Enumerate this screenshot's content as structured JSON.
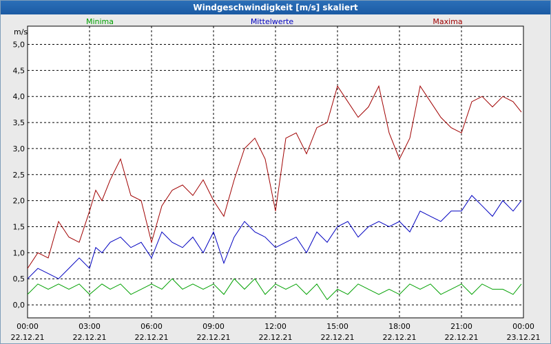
{
  "window": {
    "title": "Windgeschwindigkeit [m/s] skaliert"
  },
  "chart_data": {
    "type": "line",
    "ylabel": "m/s",
    "ylim": [
      -0.25,
      5.35
    ],
    "yticks": [
      0.0,
      0.5,
      1.0,
      1.5,
      2.0,
      2.5,
      3.0,
      3.5,
      4.0,
      4.5,
      5.0
    ],
    "ytick_labels": [
      "0,0",
      "0,5",
      "1,0",
      "1,5",
      "2,0",
      "2,5",
      "3,0",
      "3,5",
      "4,0",
      "4,5",
      "5,0"
    ],
    "xlim": [
      0,
      24
    ],
    "xticks": [
      0,
      3,
      6,
      9,
      12,
      15,
      18,
      21,
      24
    ],
    "xtick_labels": [
      [
        "00:00",
        "22.12.21"
      ],
      [
        "03:00",
        "22.12.21"
      ],
      [
        "06:00",
        "22.12.21"
      ],
      [
        "09:00",
        "22.12.21"
      ],
      [
        "12:00",
        "22.12.21"
      ],
      [
        "15:00",
        "22.12.21"
      ],
      [
        "18:00",
        "22.12.21"
      ],
      [
        "21:00",
        "22.12.21"
      ],
      [
        "00:00",
        "23.12.21"
      ]
    ],
    "grid": true,
    "legend_position": "top",
    "series": [
      {
        "name": "Minima",
        "color": "#00a000",
        "x": [
          0,
          0.5,
          1.0,
          1.5,
          2.0,
          2.5,
          3.0,
          3.3,
          3.6,
          4.0,
          4.5,
          5.0,
          5.5,
          6.0,
          6.5,
          7.0,
          7.5,
          8.0,
          8.5,
          9.0,
          9.5,
          10.0,
          10.5,
          11.0,
          11.5,
          12.0,
          12.5,
          13.0,
          13.5,
          14.0,
          14.5,
          15.0,
          15.5,
          16.0,
          16.5,
          17.0,
          17.5,
          18.0,
          18.5,
          19.0,
          19.5,
          20.0,
          20.5,
          21.0,
          21.5,
          22.0,
          22.5,
          23.0,
          23.5,
          23.9
        ],
        "y": [
          0.2,
          0.4,
          0.3,
          0.4,
          0.3,
          0.4,
          0.2,
          0.3,
          0.4,
          0.3,
          0.4,
          0.2,
          0.3,
          0.4,
          0.3,
          0.5,
          0.3,
          0.4,
          0.3,
          0.4,
          0.2,
          0.5,
          0.3,
          0.5,
          0.2,
          0.4,
          0.3,
          0.4,
          0.2,
          0.4,
          0.1,
          0.3,
          0.2,
          0.4,
          0.3,
          0.2,
          0.3,
          0.2,
          0.4,
          0.3,
          0.4,
          0.2,
          0.3,
          0.4,
          0.2,
          0.4,
          0.3,
          0.3,
          0.2,
          0.4
        ]
      },
      {
        "name": "Mittelwerte",
        "color": "#0000c0",
        "x": [
          0,
          0.5,
          1.0,
          1.5,
          2.0,
          2.5,
          3.0,
          3.3,
          3.6,
          4.0,
          4.5,
          5.0,
          5.5,
          6.0,
          6.5,
          7.0,
          7.5,
          8.0,
          8.5,
          9.0,
          9.5,
          10.0,
          10.5,
          11.0,
          11.5,
          12.0,
          12.5,
          13.0,
          13.5,
          14.0,
          14.5,
          15.0,
          15.5,
          16.0,
          16.5,
          17.0,
          17.5,
          18.0,
          18.5,
          19.0,
          19.5,
          20.0,
          20.5,
          21.0,
          21.5,
          22.0,
          22.5,
          23.0,
          23.5,
          23.9
        ],
        "y": [
          0.5,
          0.7,
          0.6,
          0.5,
          0.7,
          0.9,
          0.7,
          1.1,
          1.0,
          1.2,
          1.3,
          1.1,
          1.2,
          0.9,
          1.4,
          1.2,
          1.1,
          1.3,
          1.0,
          1.4,
          0.8,
          1.3,
          1.6,
          1.4,
          1.3,
          1.1,
          1.2,
          1.3,
          1.0,
          1.4,
          1.2,
          1.5,
          1.6,
          1.3,
          1.5,
          1.6,
          1.5,
          1.6,
          1.4,
          1.8,
          1.7,
          1.6,
          1.8,
          1.8,
          2.1,
          1.9,
          1.7,
          2.0,
          1.8,
          2.0
        ]
      },
      {
        "name": "Maxima",
        "color": "#a00000",
        "x": [
          0,
          0.5,
          1.0,
          1.5,
          2.0,
          2.5,
          3.0,
          3.3,
          3.6,
          4.0,
          4.5,
          5.0,
          5.5,
          6.0,
          6.5,
          7.0,
          7.5,
          8.0,
          8.5,
          9.0,
          9.5,
          10.0,
          10.5,
          11.0,
          11.5,
          12.0,
          12.5,
          13.0,
          13.5,
          14.0,
          14.5,
          15.0,
          15.5,
          16.0,
          16.5,
          17.0,
          17.5,
          18.0,
          18.5,
          19.0,
          19.5,
          20.0,
          20.5,
          21.0,
          21.5,
          22.0,
          22.5,
          23.0,
          23.5,
          23.9
        ],
        "y": [
          0.7,
          1.0,
          0.9,
          1.6,
          1.3,
          1.2,
          1.8,
          2.2,
          2.0,
          2.4,
          2.8,
          2.1,
          2.0,
          1.2,
          1.9,
          2.2,
          2.3,
          2.1,
          2.4,
          2.0,
          1.7,
          2.4,
          3.0,
          3.2,
          2.8,
          1.8,
          3.2,
          3.3,
          2.9,
          3.4,
          3.5,
          4.2,
          3.9,
          3.6,
          3.8,
          4.2,
          3.3,
          2.8,
          3.2,
          4.2,
          3.9,
          3.6,
          3.4,
          3.3,
          3.9,
          4.0,
          3.8,
          4.0,
          3.9,
          3.7
        ]
      }
    ]
  }
}
